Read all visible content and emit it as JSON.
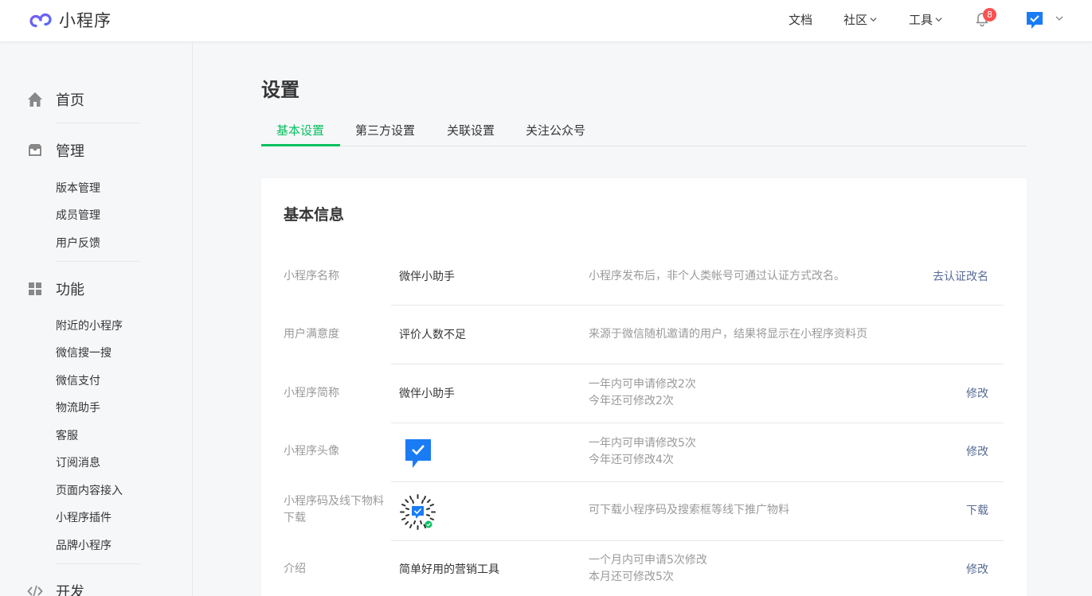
{
  "brand": {
    "name": "小程序"
  },
  "topnav": {
    "docs": "文档",
    "community": "社区",
    "tools": "工具",
    "notification_count": "8"
  },
  "sidebar": {
    "home": "首页",
    "manage": {
      "title": "管理",
      "items": [
        "版本管理",
        "成员管理",
        "用户反馈"
      ]
    },
    "features": {
      "title": "功能",
      "items": [
        "附近的小程序",
        "微信搜一搜",
        "微信支付",
        "物流助手",
        "客服",
        "订阅消息",
        "页面内容接入",
        "小程序插件",
        "品牌小程序"
      ]
    },
    "develop": {
      "title": "开发"
    }
  },
  "page": {
    "title": "设置",
    "tabs": [
      "基本设置",
      "第三方设置",
      "关联设置",
      "关注公众号"
    ],
    "active_tab": 0
  },
  "basic_info": {
    "title": "基本信息",
    "rows": [
      {
        "label": "小程序名称",
        "value": "微伴小助手",
        "desc": [
          "小程序发布后，非个人类帐号可通过认证方式改名。"
        ],
        "action": "去认证改名"
      },
      {
        "label": "用户满意度",
        "value": "评价人数不足",
        "desc": [
          "来源于微信随机邀请的用户，结果将显示在小程序资料页"
        ],
        "action": ""
      },
      {
        "label": "小程序简称",
        "value": "微伴小助手",
        "desc": [
          "一年内可申请修改2次",
          "今年还可修改2次"
        ],
        "action": "修改"
      },
      {
        "label": "小程序头像",
        "value": "",
        "desc": [
          "一年内可申请修改5次",
          "今年还可修改4次"
        ],
        "action": "修改"
      },
      {
        "label": [
          "小程序码及线下物料",
          "下载"
        ],
        "value": "",
        "desc": [
          "可下载小程序码及搜索框等线下推广物料"
        ],
        "action": "下载"
      },
      {
        "label": "介绍",
        "value": "简单好用的营销工具",
        "desc": [
          "一个月内可申请5次修改",
          "本月还可修改5次"
        ],
        "action": "修改"
      }
    ]
  },
  "colors": {
    "accent": "#07c160",
    "link": "#576b95",
    "badge": "#fa5151",
    "avatar_blue": "#1a7cf5"
  },
  "icons": [
    "home-icon",
    "inbox-icon",
    "grid-icon",
    "code-icon",
    "bell-icon",
    "chevron-down-icon"
  ]
}
